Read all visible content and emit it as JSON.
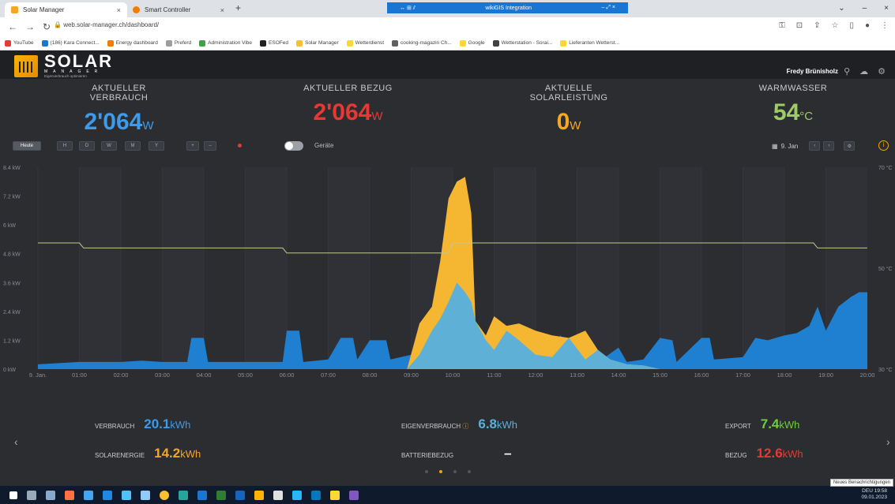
{
  "browser": {
    "tabs": [
      {
        "label": "Solar Manager",
        "close": "×"
      },
      {
        "label": "Smart Controller",
        "close": "×"
      }
    ],
    "new_tab": "+",
    "screen_share": {
      "controls": "↔ ⊞ ⫽",
      "host": "wikiGIS Integration",
      "actions": "– ⤢ ×"
    },
    "window_controls": [
      "⌄",
      "–",
      "×"
    ],
    "url": "web.solar-manager.ch/dashboard/",
    "bookmarks": [
      {
        "label": "YouTube",
        "color": "#e53935"
      },
      {
        "label": "(186) Kara Connect...",
        "color": "#1976d2"
      },
      {
        "label": "Energy dashboard",
        "color": "#f57c00"
      },
      {
        "label": "Preferd",
        "color": "#9e9e9e"
      },
      {
        "label": "Administration Vibe",
        "color": "#43a047"
      },
      {
        "label": "ESOFed",
        "color": "#212121"
      },
      {
        "label": "Solar Manager",
        "color": "#fbc02d"
      },
      {
        "label": "Wetterdienst",
        "color": "#fdd835"
      },
      {
        "label": "cooking-magazin Ch...",
        "color": "#616161"
      },
      {
        "label": "Google",
        "color": "#fdd835"
      },
      {
        "label": "Wetterstation - Sorai...",
        "color": "#424242"
      },
      {
        "label": "Lieferanten Wetterst...",
        "color": "#fdd835"
      }
    ]
  },
  "app": {
    "logo": {
      "word": "SOLAR",
      "sub": "MANAGER",
      "tag": "Eigenverbrauch optimieren"
    },
    "user": "Fredy Brünisholz"
  },
  "kpis": [
    {
      "label": "AKTUELLER VERBRAUCH",
      "value": "2'064",
      "unit": "W",
      "color": "#3d9be9"
    },
    {
      "label": "AKTUELLER BEZUG",
      "value": "2'064",
      "unit": "W",
      "color": "#e53935"
    },
    {
      "label": "AKTUELLE SOLARLEISTUNG",
      "value": "0",
      "unit": "W",
      "color": "#f5a623"
    },
    {
      "label": "WARMWASSER",
      "value": "54",
      "unit": "°C",
      "color": "#9ccc65"
    }
  ],
  "controls": {
    "today": "Heute",
    "periods": [
      "H",
      "D",
      "W",
      "M",
      "Y"
    ],
    "zoom": [
      "+",
      "–"
    ],
    "toggle_label": "Geräte",
    "date": "9. Jan",
    "prev": "‹",
    "next": "›",
    "settings": "⚙",
    "info": "i"
  },
  "chart_data": {
    "type": "area",
    "y_ticks": [
      "8.4 kW",
      "7.2 kW",
      "6 kW",
      "4.8 kW",
      "3.6 kW",
      "2.4 kW",
      "1.2 kW",
      "0 kW"
    ],
    "y_right_ticks": [
      "70 °C",
      "50 °C",
      "30 °C"
    ],
    "x_ticks": [
      "9. Jan.",
      "01:00",
      "02:00",
      "03:00",
      "04:00",
      "05:00",
      "06:00",
      "07:00",
      "08:00",
      "09:00",
      "10:00",
      "11:00",
      "12:00",
      "13:00",
      "14:00",
      "15:00",
      "16:00",
      "17:00",
      "18:00",
      "19:00",
      "20:00"
    ],
    "ylim": [
      0,
      8.4
    ],
    "ylim_right": [
      30,
      70
    ],
    "consumption_color": "#1f7fd0",
    "solar_color": "#f5b731",
    "selfuse_color": "#5fb0d6",
    "temp_color": "#c2c98a",
    "consumption": [
      [
        0,
        0.2
      ],
      [
        0.5,
        0.25
      ],
      [
        1,
        0.3
      ],
      [
        1.5,
        0.3
      ],
      [
        2,
        0.3
      ],
      [
        2.5,
        0.35
      ],
      [
        3,
        0.3
      ],
      [
        3.6,
        0.3
      ],
      [
        3.7,
        1.3
      ],
      [
        4,
        1.3
      ],
      [
        4.1,
        0.3
      ],
      [
        5,
        0.3
      ],
      [
        5.9,
        0.3
      ],
      [
        6,
        1.6
      ],
      [
        6.3,
        1.6
      ],
      [
        6.4,
        0.3
      ],
      [
        7,
        0.4
      ],
      [
        7.3,
        1.3
      ],
      [
        7.6,
        1.3
      ],
      [
        7.7,
        0.4
      ],
      [
        8,
        1.2
      ],
      [
        8.4,
        1.2
      ],
      [
        8.5,
        0.4
      ],
      [
        9,
        0.6
      ],
      [
        9.2,
        1.6
      ],
      [
        9.5,
        2.1
      ],
      [
        9.8,
        2.8
      ],
      [
        10,
        3.6
      ],
      [
        10.2,
        3.2
      ],
      [
        10.4,
        2.8
      ],
      [
        10.6,
        1.2
      ],
      [
        10.8,
        0.8
      ],
      [
        11,
        1.6
      ],
      [
        11.3,
        1.2
      ],
      [
        11.6,
        0.6
      ],
      [
        12,
        1.4
      ],
      [
        12.3,
        0.5
      ],
      [
        12.6,
        1.4
      ],
      [
        13,
        0.4
      ],
      [
        13.3,
        1.3
      ],
      [
        13.6,
        0.4
      ],
      [
        14,
        0.9
      ],
      [
        14.2,
        0.3
      ],
      [
        14.6,
        0.4
      ],
      [
        15,
        1.3
      ],
      [
        15.3,
        1.2
      ],
      [
        15.4,
        0.3
      ],
      [
        16,
        1.3
      ],
      [
        16.2,
        1.3
      ],
      [
        16.3,
        0.4
      ],
      [
        17,
        0.5
      ],
      [
        17.3,
        1.3
      ],
      [
        17.6,
        1.2
      ],
      [
        18,
        1.4
      ],
      [
        18.3,
        1.5
      ],
      [
        18.6,
        1.8
      ],
      [
        18.8,
        2.6
      ],
      [
        19,
        1.6
      ],
      [
        19.3,
        2.6
      ],
      [
        19.6,
        3.0
      ],
      [
        19.8,
        3.2
      ],
      [
        20,
        3.2
      ]
    ],
    "solar": [
      [
        8.9,
        0
      ],
      [
        9.2,
        1.9
      ],
      [
        9.5,
        2.6
      ],
      [
        9.7,
        4.5
      ],
      [
        9.9,
        7.1
      ],
      [
        10.1,
        7.8
      ],
      [
        10.3,
        8.0
      ],
      [
        10.45,
        6.5
      ],
      [
        10.55,
        2.0
      ],
      [
        10.8,
        1.4
      ],
      [
        11,
        2.2
      ],
      [
        11.3,
        1.8
      ],
      [
        11.6,
        1.9
      ],
      [
        12,
        1.6
      ],
      [
        12.4,
        1.4
      ],
      [
        12.8,
        1.3
      ],
      [
        13.2,
        1.6
      ],
      [
        13.5,
        0.8
      ],
      [
        13.8,
        0.4
      ],
      [
        14.2,
        0.2
      ],
      [
        14.6,
        0.15
      ],
      [
        15,
        0
      ]
    ],
    "temperature": [
      [
        0,
        55
      ],
      [
        1,
        55
      ],
      [
        1.1,
        54
      ],
      [
        5.9,
        54
      ],
      [
        6,
        53
      ],
      [
        9.9,
        53
      ],
      [
        10,
        55
      ],
      [
        18.7,
        55
      ],
      [
        18.8,
        54
      ],
      [
        20,
        54
      ]
    ]
  },
  "summary": {
    "verbrauch": {
      "label": "VERBRAUCH",
      "value": "20.1",
      "unit": "kWh",
      "color": "#3d9be9"
    },
    "solarenergie": {
      "label": "SOLARENERGIE",
      "value": "14.2",
      "unit": "kWh",
      "color": "#f5a623"
    },
    "eigenverbrauch": {
      "label": "EIGENVERBRAUCH",
      "icon": "ⓘ",
      "value": "6.8",
      "unit": "kWh",
      "color": "#5fb0d6"
    },
    "batteriebezug": {
      "label": "BATTERIEBEZUG",
      "value": "–",
      "color": "#ffffff"
    },
    "export": {
      "label": "EXPORT",
      "value": "7.4",
      "unit": "kWh",
      "color": "#6ccf3c"
    },
    "bezug": {
      "label": "BEZUG",
      "value": "12.6",
      "unit": "kWh",
      "color": "#e53935"
    },
    "left_arrow": "‹",
    "right_arrow": "›"
  },
  "taskbar": {
    "time": "19:58",
    "date": "09.01.2023",
    "lang": "DEU",
    "tooltip": "Neues Benachrichtigungen"
  }
}
